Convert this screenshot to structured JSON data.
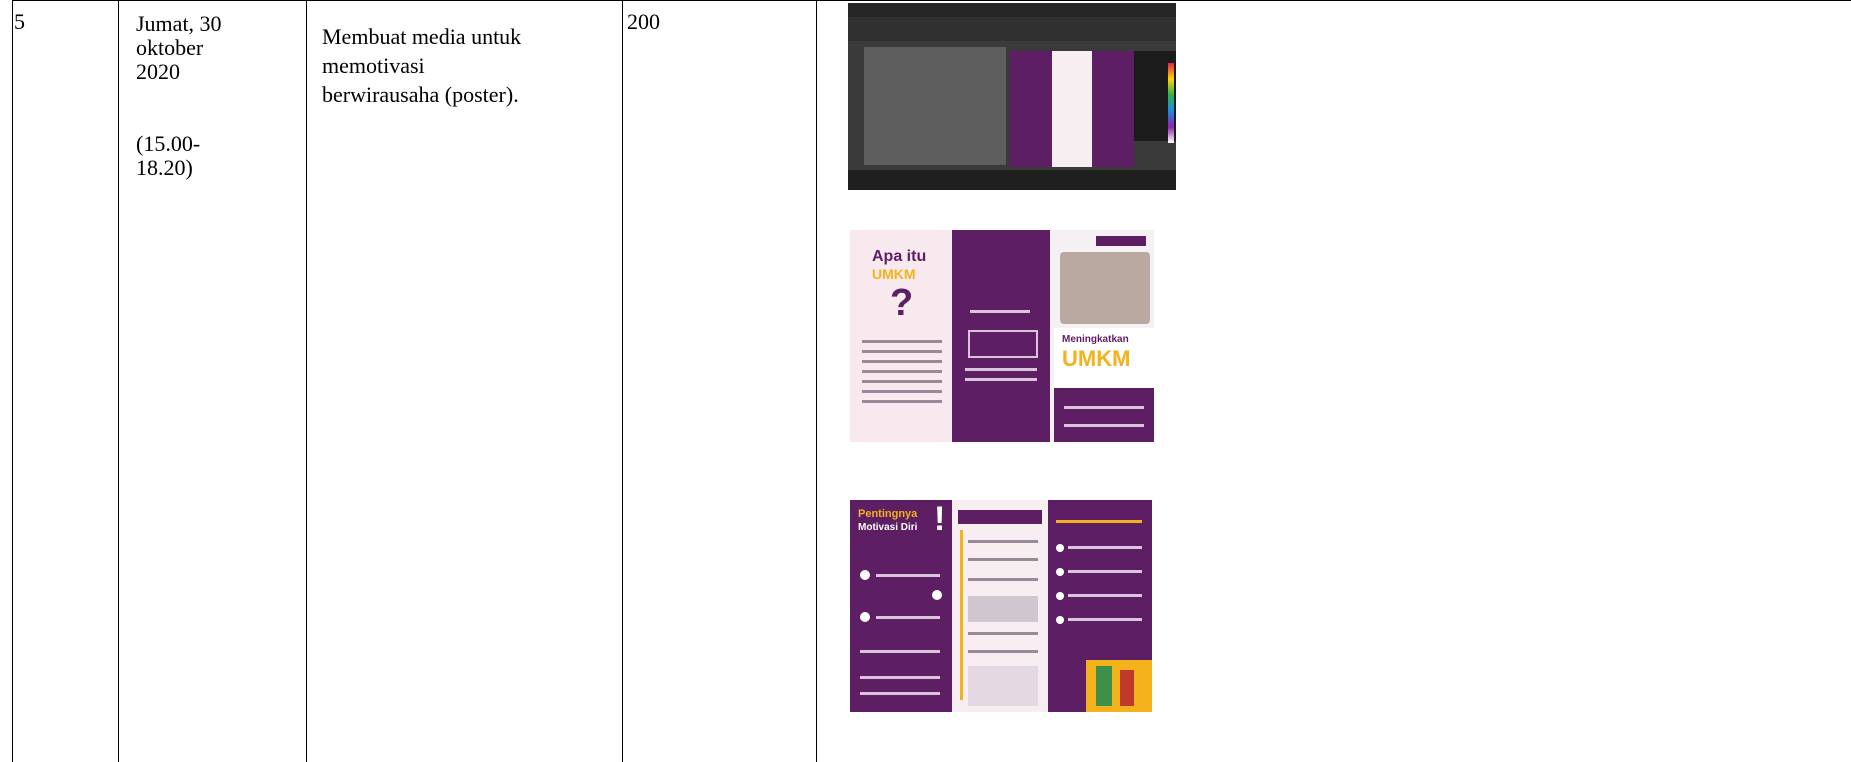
{
  "row": {
    "number": "5",
    "date_lines": [
      "Jumat, 30",
      "oktober",
      "2020"
    ],
    "time_lines": [
      "(15.00-",
      "18.20)"
    ],
    "activity_lines": [
      "Membuat media untuk",
      "memotivasi",
      "berwirausaha (poster)."
    ],
    "duration": "200"
  },
  "brochure_outer": {
    "heading_line1": "Apa itu",
    "heading_line2": "UMKM",
    "heading_mark": "?",
    "cover_line1": "Meningkatkan",
    "cover_line2": "UMKM"
  },
  "brochure_inner": {
    "heading_line1": "Pentingnya",
    "heading_line2": "Motivasi Diri",
    "heading_mark": "!"
  },
  "colors": {
    "brochure_purple": "#5e1e64",
    "brochure_pink": "#f7e9ee",
    "brochure_yellow": "#f3b21b"
  }
}
